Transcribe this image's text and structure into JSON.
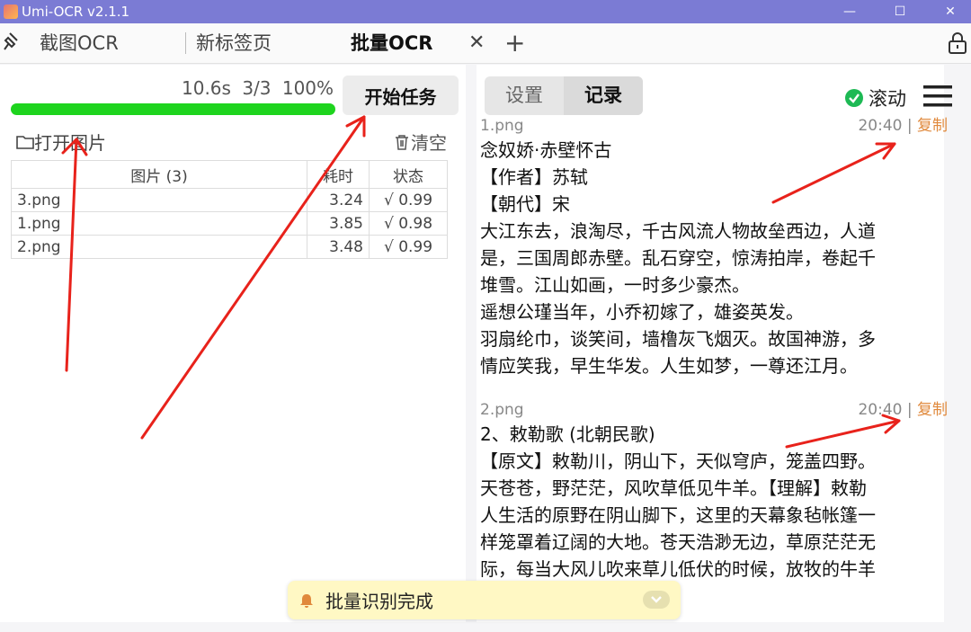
{
  "window": {
    "title": "Umi-OCR v2.1.1",
    "minimize": "—",
    "maximize": "☐",
    "close": "✕"
  },
  "tabs": [
    {
      "label": "截图OCR"
    },
    {
      "label": "新标签页"
    },
    {
      "label": "批量OCR"
    }
  ],
  "tab_close": "✕",
  "tab_add": "+",
  "left": {
    "stats": {
      "time": "10.6s",
      "count": "3/3",
      "percent": "100%"
    },
    "progress": 1.0,
    "start_button": "开始任务",
    "open_images": "打开图片",
    "clear": "清空",
    "table": {
      "headers": [
        "图片 (3)",
        "耗时",
        "状态"
      ],
      "rows": [
        {
          "file": "3.png",
          "time": "3.24",
          "status": "√ 0.99"
        },
        {
          "file": "1.png",
          "time": "3.85",
          "status": "√ 0.98"
        },
        {
          "file": "2.png",
          "time": "3.48",
          "status": "√ 0.99"
        }
      ]
    }
  },
  "right": {
    "tabs": {
      "settings": "设置",
      "records": "记录"
    },
    "scroll_label": "滚动",
    "records": [
      {
        "file": "1.png",
        "time": "20:40",
        "copy": "复制",
        "lines": [
          "念奴娇·赤壁怀古",
          "【作者】苏轼",
          "【朝代】宋",
          "大江东去，浪淘尽，千古风流人物故垒西边，人道",
          "是，三国周郎赤壁。乱石穿空，惊涛拍岸，卷起千",
          "堆雪。江山如画，一时多少豪杰。",
          "遥想公瑾当年，小乔初嫁了，雄姿英发。",
          "羽扇纶巾，谈笑间，墙橹灰飞烟灭。故国神游，多",
          "情应笑我，早生华发。人生如梦，一尊还江月。"
        ]
      },
      {
        "file": "2.png",
        "time": "20:40",
        "copy": "复制",
        "lines": [
          "2、敕勒歌 (北朝民歌)",
          "【原文】敕勒川，阴山下，天似穹庐，笼盖四野。",
          "天苍苍，野茫茫，风吹草低见牛羊。【理解】敕勒",
          "人生活的原野在阴山脚下，这里的天幕象毡帐篷一",
          "样笼罩着辽阔的大地。苍天浩渺无边，草原茫茫无",
          "际，每当大风儿吹来草儿低伏的时候，放牧的牛羊"
        ]
      }
    ]
  },
  "toast": {
    "text": "批量识别完成"
  },
  "colors": {
    "titlebar": "#7b7bd4",
    "progress": "#1ed41e",
    "check": "#1db954",
    "copy": "#e0893c",
    "annotation_arrow": "#e8221b"
  }
}
